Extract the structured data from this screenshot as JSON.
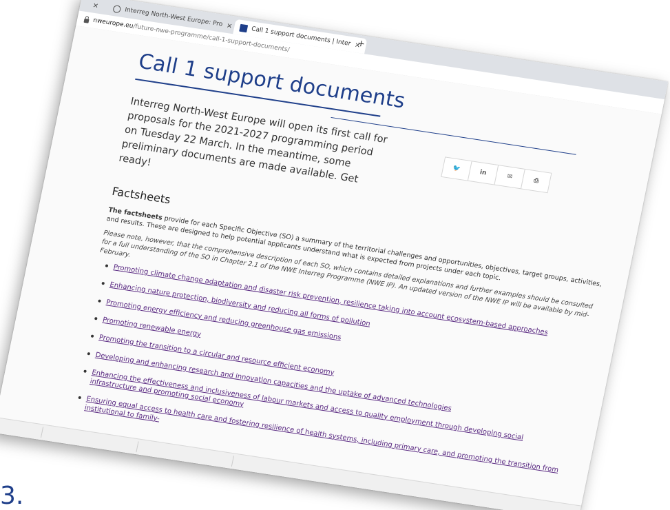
{
  "browser": {
    "tabs": [
      {
        "title": "Interreg North-West Europe: Pro",
        "close": "×"
      },
      {
        "title": "Call 1 support documents | Inter",
        "close": "×"
      }
    ],
    "first_tab_close": "×",
    "new_tab": "+",
    "url_host": "nweurope.eu",
    "url_path": "/future-nwe-programme/call-1-support-documents/"
  },
  "page": {
    "title": "Call 1 support documents",
    "intro": "Interreg North-West Europe will open its first call for proposals for the 2021-2027 programming period on Tuesday 22 March. In the meantime, some preliminary documents are made available. Get ready!",
    "share": [
      {
        "label": "🐦",
        "icon": "twitter-icon"
      },
      {
        "label": "in",
        "icon": "linkedin-icon"
      },
      {
        "label": "✉",
        "icon": "mail-icon"
      },
      {
        "label": "⎙",
        "icon": "print-icon"
      }
    ],
    "section_title": "Factsheets",
    "para1_bold": "The factsheets",
    "para1_rest": " provide for each Specific Objective (SO) a summary of the territorial challenges and opportunities, objectives, target groups, activities, and results. These are designed to help potential applicants understand what is expected from projects under each topic.",
    "para2": "Please note, however, that the comprehensive description of each SO, which contains detailed explanations and further examples should be consulted for a full understanding of the SO in Chapter 2.1 of the NWE Interreg Programme (NWE IP). An updated version of the NWE IP will be available by mid-February.",
    "links": [
      "Promoting climate change adaptation and disaster risk prevention, resilience taking into account ecosystem-based approaches",
      "Enhancing nature protection, biodiversity and reducing all forms of pollution",
      "Promoting energy efficiency and reducing greenhouse gas emissions",
      "Promoting renewable energy",
      "Promoting the transition to a circular and resource efficient economy",
      "Developing and enhancing research and innovation capacities and the uptake of advanced technologies",
      "Enhancing the effectiveness and inclusiveness of labour markets and access to quality employment through developing social infrastructure and promoting social economy",
      "Ensuring equal access to health care and fostering resilience of health systems, including primary care, and promoting the transition from institutional to family-"
    ]
  },
  "stray_text": "3."
}
